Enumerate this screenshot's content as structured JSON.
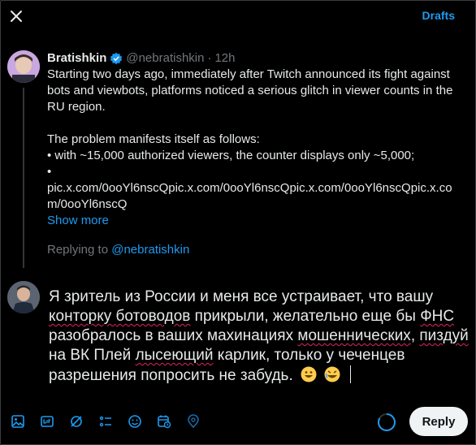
{
  "header": {
    "drafts_label": "Drafts"
  },
  "original_tweet": {
    "name": "Bratishkin",
    "handle": "@nebratishkin",
    "separator": "·",
    "time": "12h",
    "paragraph1": "Starting two days ago, immediately after Twitch announced its fight against bots and viewbots, platforms noticed a serious glitch in viewer counts in the RU region.",
    "paragraph2_line1": "The problem manifests itself as follows:",
    "paragraph2_line2": "• with ~15,000 authorized viewers, the counter displays only ~5,000;",
    "paragraph2_line3": "•",
    "links": "pic.x.com/0ooYl6nscQpic.x.com/0ooYl6nscQpic.x.com/0ooYl6nscQpic.x.com/0ooYl6nscQ",
    "show_more": "Show more"
  },
  "replying": {
    "prefix": "Replying to",
    "handle": "@nebratishkin"
  },
  "reply": {
    "t1": "Я зритель из России и меня все устраивает, что вашу ",
    "t2": "конторку ",
    "t3": "ботоводов",
    "t4": " прикрыли, желательно еще бы ",
    "t5": "ФНС",
    "t6": " разобралось в ваших махинациях ",
    "t7": "мошеннических",
    "t8": ", ",
    "t9": "пиздуй",
    "t10": " на ВК Плей ",
    "t11": "лысеющий",
    "t12": " карлик, только у чеченцев разрешения попросить не забудь."
  },
  "toolbar": {
    "icons": [
      "image-icon",
      "gif-icon",
      "grok-icon",
      "poll-icon",
      "emoji-icon",
      "schedule-icon",
      "location-icon"
    ],
    "reply_label": "Reply"
  },
  "colors": {
    "accent": "#1d9bf0",
    "background": "#000000",
    "text": "#e7e9ea",
    "muted": "#71767b"
  }
}
